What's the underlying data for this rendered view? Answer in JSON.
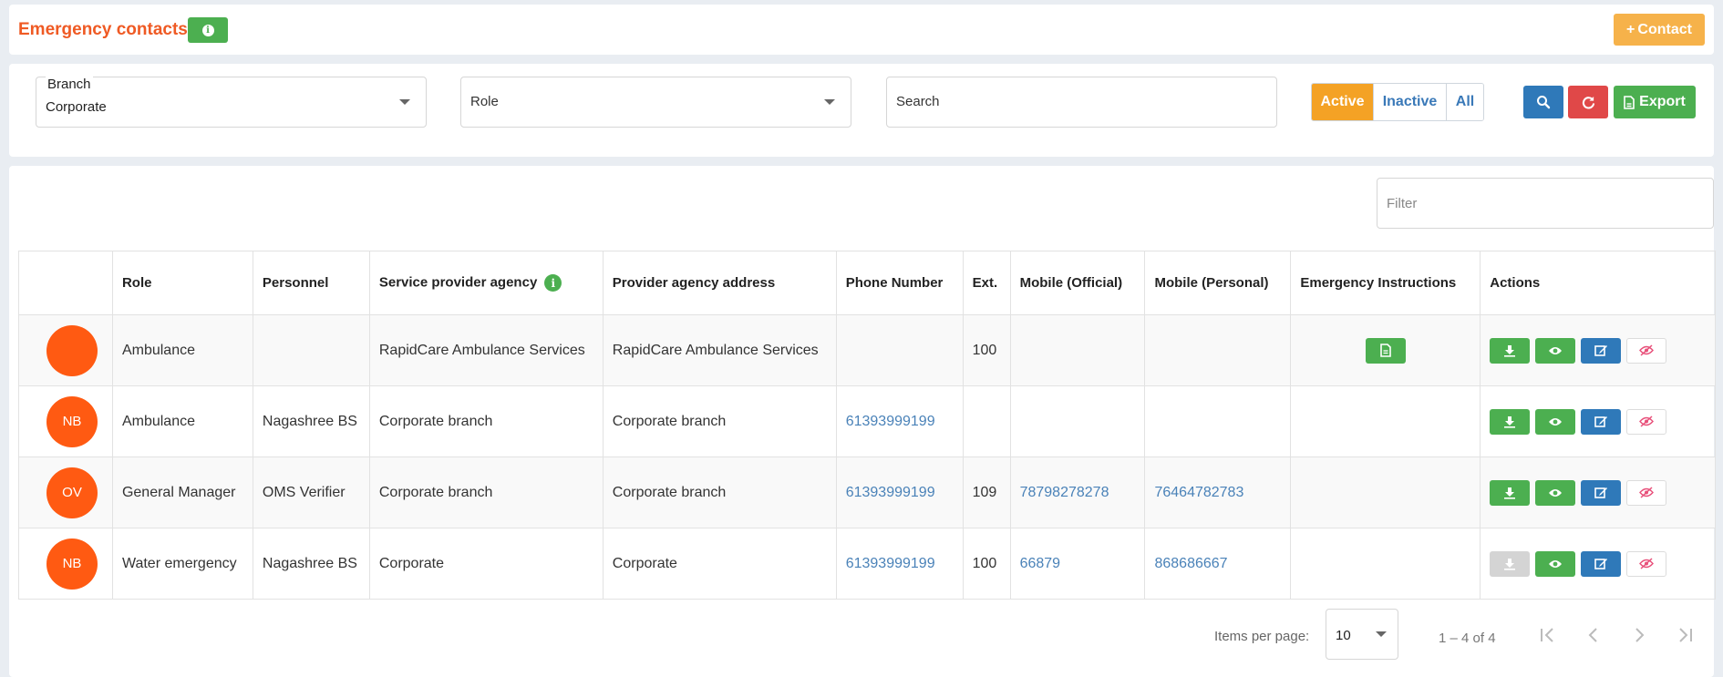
{
  "header": {
    "title": "Emergency contacts",
    "info_icon": "info-icon",
    "add_contact_label": "Contact",
    "accent": "#ef5a24"
  },
  "filters": {
    "branch_label": "Branch",
    "branch_value": "Corporate",
    "role_placeholder": "Role",
    "search_placeholder": "Search",
    "status_options": [
      "Active",
      "Inactive",
      "All"
    ],
    "status_selected": "Active",
    "export_label": "Export"
  },
  "table": {
    "filter_placeholder": "Filter",
    "columns": [
      "",
      "Role",
      "Personnel",
      "Service provider agency",
      "Provider agency address",
      "Phone Number",
      "Ext.",
      "Mobile (Official)",
      "Mobile (Personal)",
      "Emergency Instructions",
      "Actions"
    ],
    "rows": [
      {
        "initials": "",
        "role": "Ambulance",
        "personnel": "",
        "agency": "RapidCare Ambulance Services",
        "address": "RapidCare Ambulance Services",
        "phone": "",
        "ext": "100",
        "mobile_official": "",
        "mobile_personal": "",
        "has_instructions": true,
        "download_enabled": true
      },
      {
        "initials": "NB",
        "role": "Ambulance",
        "personnel": "Nagashree BS",
        "agency": "Corporate branch",
        "address": "Corporate branch",
        "phone": "61393999199",
        "ext": "",
        "mobile_official": "",
        "mobile_personal": "",
        "has_instructions": false,
        "download_enabled": true
      },
      {
        "initials": "OV",
        "role": "General Manager",
        "personnel": "OMS Verifier",
        "agency": "Corporate branch",
        "address": "Corporate branch",
        "phone": "61393999199",
        "ext": "109",
        "mobile_official": "78798278278",
        "mobile_personal": "76464782783",
        "has_instructions": false,
        "download_enabled": true
      },
      {
        "initials": "NB",
        "role": "Water emergency",
        "personnel": "Nagashree BS",
        "agency": "Corporate",
        "address": "Corporate",
        "phone": "61393999199",
        "ext": "100",
        "mobile_official": "66879",
        "mobile_personal": "868686667",
        "has_instructions": false,
        "download_enabled": false
      }
    ]
  },
  "pagination": {
    "items_per_page_label": "Items per page:",
    "items_per_page": "10",
    "range": "1 – 4 of 4"
  }
}
